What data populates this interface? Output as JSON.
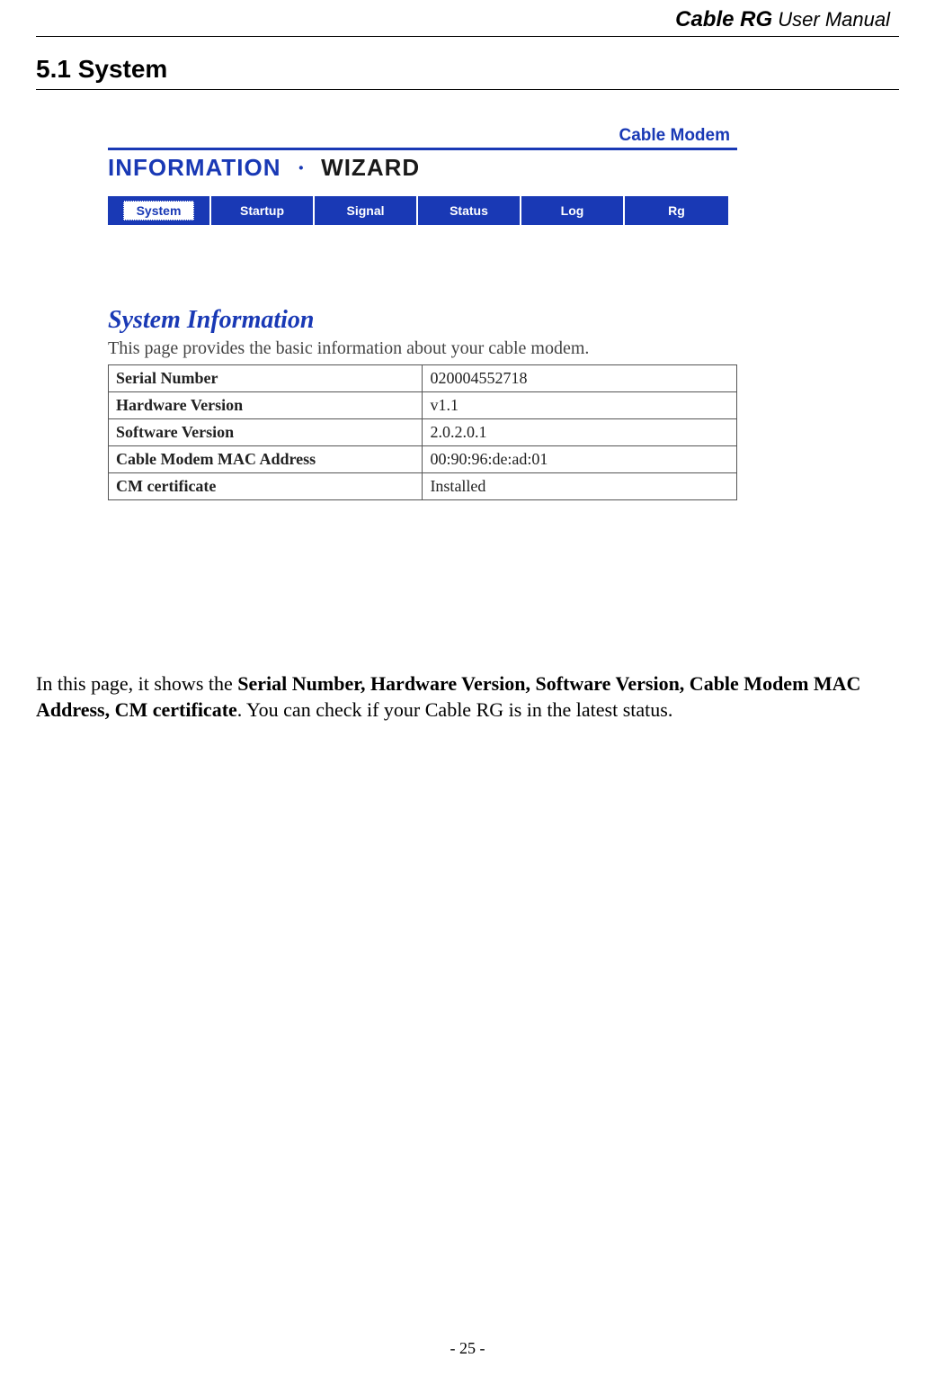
{
  "header": {
    "title_em": "Cable RG",
    "title_rest": " User Manual"
  },
  "section": {
    "heading": "5.1 System"
  },
  "banner": {
    "modem_label": "Cable Modem",
    "info": "INFORMATION",
    "dot": "·",
    "wizard": "WIZARD"
  },
  "tabs": [
    {
      "label": "System",
      "active": true
    },
    {
      "label": "Startup",
      "active": false
    },
    {
      "label": "Signal",
      "active": false
    },
    {
      "label": "Status",
      "active": false
    },
    {
      "label": "Log",
      "active": false
    },
    {
      "label": "Rg",
      "active": false
    }
  ],
  "sysinfo": {
    "heading": "System Information",
    "description": "This page provides the basic information about your cable modem.",
    "rows": [
      {
        "key": "Serial Number",
        "value": "020004552718"
      },
      {
        "key": "Hardware Version",
        "value": "v1.1"
      },
      {
        "key": "Software Version",
        "value": "2.0.2.0.1"
      },
      {
        "key": "Cable Modem MAC Address",
        "value": "00:90:96:de:ad:01"
      },
      {
        "key": "CM certificate",
        "value": "Installed"
      }
    ]
  },
  "body_text": {
    "pre": "In this page, it shows the ",
    "bold": "Serial Number, Hardware Version, Software Version, Cable Modem MAC Address, CM certificate",
    "post": ". You can check if your Cable RG is in the latest status."
  },
  "page_number": "- 25 -"
}
